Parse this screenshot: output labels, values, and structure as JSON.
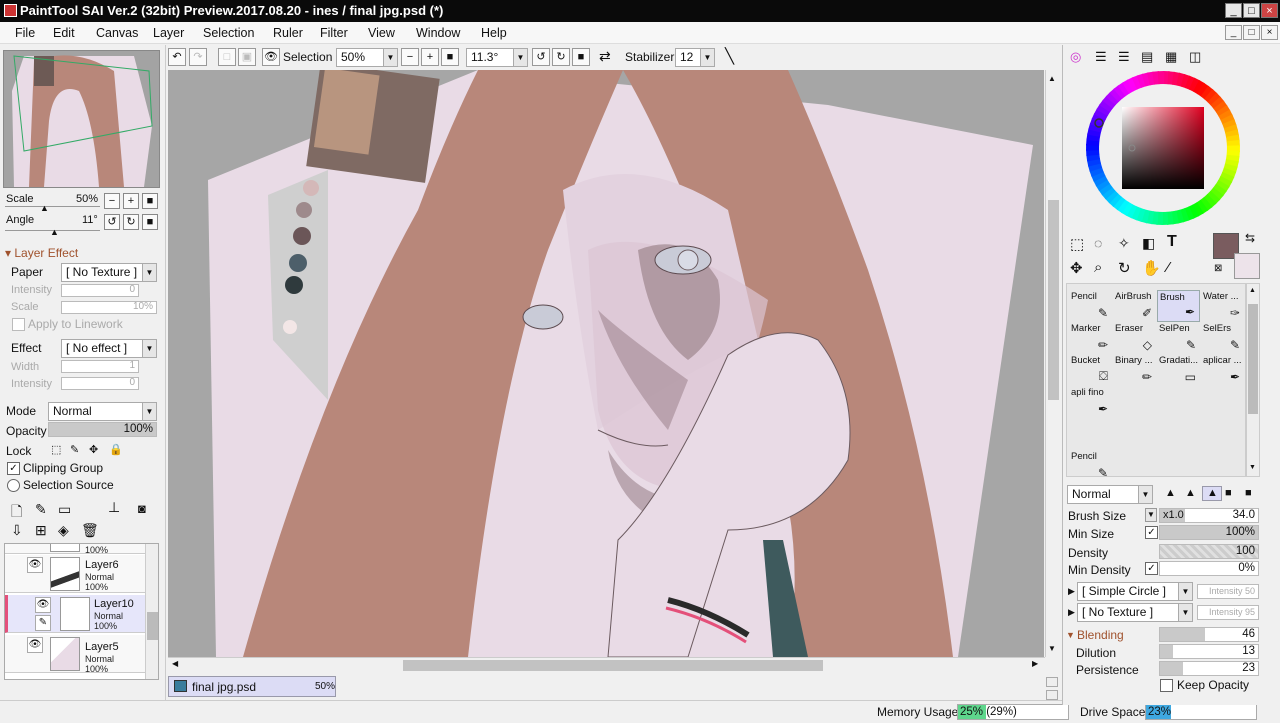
{
  "window": {
    "title": "PaintTool SAI Ver.2 (32bit) Preview.2017.08.20 - ines / final jpg.psd (*)",
    "min": "_",
    "max": "□",
    "close": "×"
  },
  "menu": [
    "File",
    "Edit",
    "Canvas",
    "Layer",
    "Selection",
    "Ruler",
    "View",
    "Window",
    "Help"
  ],
  "toolbar": {
    "selection_label": "Selection",
    "zoom": "50%",
    "rotation": "11.3°",
    "stabilizer_label": "Stabilizer",
    "stabilizer_value": "12"
  },
  "navigator": {
    "scale_label": "Scale",
    "scale_value": "50%",
    "angle_label": "Angle",
    "angle_value": "11°"
  },
  "layer_effect": {
    "header": "Layer Effect",
    "paper_label": "Paper",
    "paper_value": "[ No Texture ]",
    "intensity_label": "Intensity",
    "intensity_value": "0",
    "scale_label": "Scale",
    "scale_value": "10%",
    "apply_linework": "Apply to Linework",
    "effect_label": "Effect",
    "effect_value": "[ No effect ]",
    "width_label": "Width",
    "width_value": "1",
    "effect_intensity_label": "Intensity",
    "effect_intensity_value": "0"
  },
  "layer_props": {
    "mode_label": "Mode",
    "mode_value": "Normal",
    "opacity_label": "Opacity",
    "opacity_value": "100%",
    "lock_label": "Lock",
    "clipping_group": "Clipping Group",
    "selection_source": "Selection Source"
  },
  "layers": [
    {
      "name": "",
      "mode": "",
      "opacity": "100%"
    },
    {
      "name": "Layer6",
      "mode": "Normal",
      "opacity": "100%"
    },
    {
      "name": "Layer10",
      "mode": "Normal",
      "opacity": "100%"
    },
    {
      "name": "Layer5",
      "mode": "Normal",
      "opacity": "100%"
    }
  ],
  "tabs": [
    {
      "name": "final jpg.psd",
      "zoom": "50%"
    }
  ],
  "status": {
    "memory_label": "Memory Usage",
    "memory_value": "25% (29%)",
    "memory_fill": 0.25,
    "drive_label": "Drive Space",
    "drive_value": "23%",
    "drive_fill": 0.23
  },
  "colors": {
    "primary": "#7a5c5f",
    "secondary": "#ede3ea",
    "hair": "#b8877a",
    "skin": "#e9dbe6",
    "accent_pink": "#e4507a"
  },
  "tools": [
    {
      "name": "Pencil",
      "icon": "pencil-icon"
    },
    {
      "name": "AirBrush",
      "icon": "airbrush-icon"
    },
    {
      "name": "Brush",
      "icon": "brush-icon",
      "selected": true
    },
    {
      "name": "Water ...",
      "icon": "water-icon"
    },
    {
      "name": "Marker",
      "icon": "marker-icon"
    },
    {
      "name": "Eraser",
      "icon": "eraser-icon"
    },
    {
      "name": "SelPen",
      "icon": "selpen-icon"
    },
    {
      "name": "SelErs",
      "icon": "selers-icon"
    },
    {
      "name": "Bucket",
      "icon": "bucket-icon"
    },
    {
      "name": "Binary ...",
      "icon": "binary-icon"
    },
    {
      "name": "Gradati...",
      "icon": "gradient-icon"
    },
    {
      "name": "aplicar ...",
      "icon": "aplicar-icon"
    },
    {
      "name": "apli fino",
      "icon": "aplifino-icon"
    },
    {
      "name": "Pencil",
      "icon": "pencil-icon"
    }
  ],
  "brush": {
    "mode_value": "Normal",
    "size_label": "Brush Size",
    "size_mult": "x1.0",
    "size_value": "34.0",
    "min_size_label": "Min Size",
    "min_size_value": "100%",
    "density_label": "Density",
    "density_value": "100",
    "min_density_label": "Min Density",
    "min_density_value": "0%",
    "shape_value": "[ Simple Circle ]",
    "shape_intensity": "Intensity 50",
    "texture_value": "[ No Texture ]",
    "texture_intensity": "Intensity 95",
    "blending_label": "Blending",
    "blending_value": "46",
    "dilution_label": "Dilution",
    "dilution_value": "13",
    "persistence_label": "Persistence",
    "persistence_value": "23",
    "keep_opacity": "Keep Opacity"
  }
}
